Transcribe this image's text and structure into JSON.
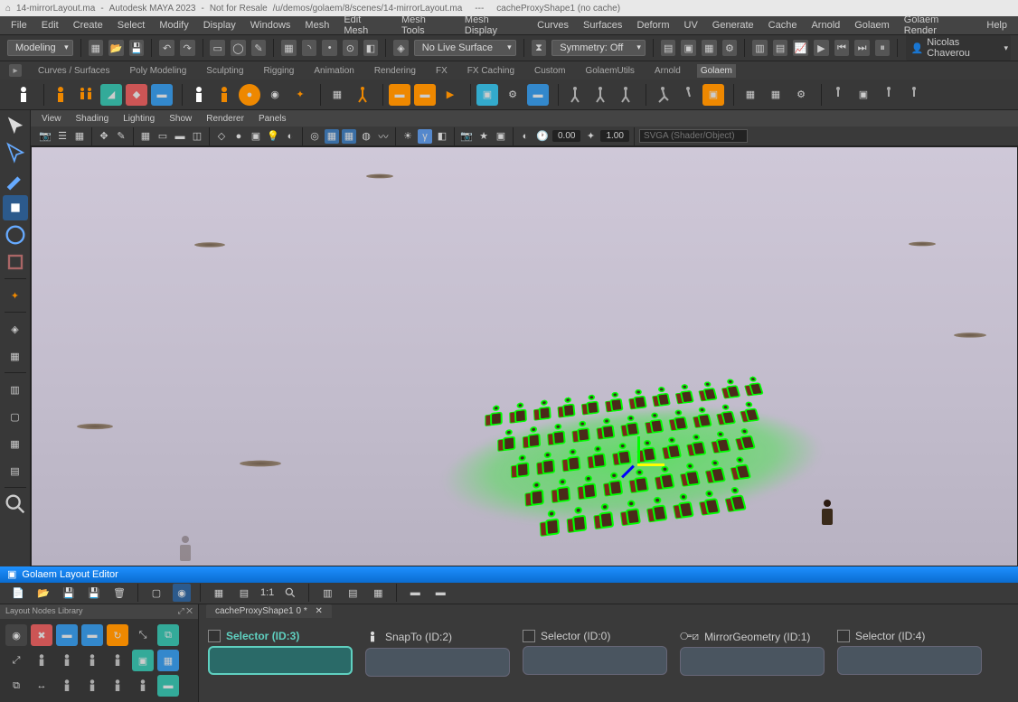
{
  "title_bar": {
    "file": "14-mirrorLayout.ma",
    "app": "Autodesk MAYA 2023",
    "note": "Not for Resale",
    "path": "/u/demos/golaem/8/scenes/14-mirrorLayout.ma",
    "extra": "cacheProxyShape1 (no cache)"
  },
  "main_menu": [
    "File",
    "Edit",
    "Create",
    "Select",
    "Modify",
    "Display",
    "Windows",
    "Mesh",
    "Edit Mesh",
    "Mesh Tools",
    "Mesh Display",
    "Curves",
    "Surfaces",
    "Deform",
    "UV",
    "Generate",
    "Cache",
    "Arnold",
    "Golaem",
    "Golaem Render",
    "Help"
  ],
  "mode_dropdown": "Modeling",
  "surface_dropdown": "No Live Surface",
  "symmetry_dropdown": "Symmetry: Off",
  "user_name": "Nicolas Chaverou",
  "shelf_tabs": [
    "Curves / Surfaces",
    "Poly Modeling",
    "Sculpting",
    "Rigging",
    "Animation",
    "Rendering",
    "FX",
    "FX Caching",
    "Custom",
    "GolaemUtils",
    "Arnold",
    "Golaem"
  ],
  "shelf_active": "Golaem",
  "viewport_menu": [
    "View",
    "Shading",
    "Lighting",
    "Show",
    "Renderer",
    "Panels"
  ],
  "viewport_time1": "0.00",
  "viewport_time2": "1.00",
  "viewport_search_ph": "SVGA (Shader/Object)",
  "layout_editor": {
    "title": "Golaem Layout Editor",
    "ratio": "1:1",
    "library_title": "Layout Nodes Library",
    "tab": "cacheProxyShape1 0 *",
    "nodes": [
      {
        "label": "Selector (ID:3)",
        "active": true,
        "icon": "selector"
      },
      {
        "label": "SnapTo (ID:2)",
        "active": false,
        "icon": "figure"
      },
      {
        "label": "Selector (ID:0)",
        "active": false,
        "icon": "selector"
      },
      {
        "label": "MirrorGeometry (ID:1)",
        "active": false,
        "icon": "mirror"
      },
      {
        "label": "Selector (ID:4)",
        "active": false,
        "icon": "selector"
      }
    ]
  }
}
